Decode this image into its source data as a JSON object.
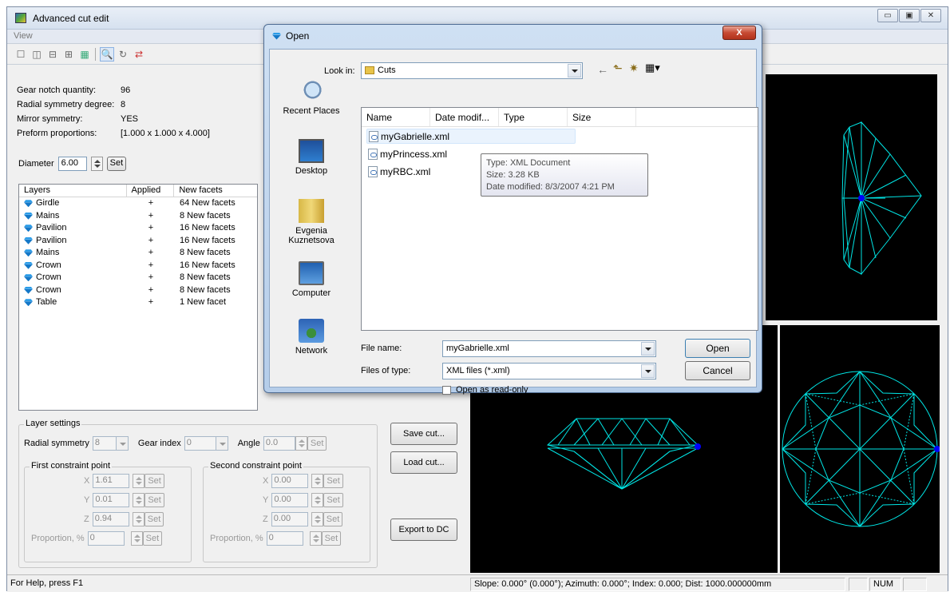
{
  "app": {
    "title": "Advanced cut edit",
    "menu": "View",
    "window_buttons": [
      "▭",
      "▣",
      "✕"
    ]
  },
  "info": {
    "gear_label": "Gear notch quantity:",
    "gear_value": "96",
    "radial_label": "Radial symmetry degree:",
    "radial_value": "8",
    "mirror_label": "Mirror symmetry:",
    "mirror_value": "YES",
    "preform_label": "Preform proportions:",
    "preform_value": "[1.000 x 1.000 x 4.000]",
    "diameter_label": "Diameter",
    "diameter_value": "6.00",
    "set_label": "Set"
  },
  "layers": {
    "headers": [
      "Layers",
      "Applied",
      "New facets"
    ],
    "rows": [
      {
        "name": "Girdle",
        "applied": "+",
        "facets": "64 New facets"
      },
      {
        "name": "Mains",
        "applied": "+",
        "facets": "8 New facets"
      },
      {
        "name": "Pavilion",
        "applied": "+",
        "facets": "16 New facets"
      },
      {
        "name": "Pavilion",
        "applied": "+",
        "facets": "16 New facets"
      },
      {
        "name": "Mains",
        "applied": "+",
        "facets": "8 New facets"
      },
      {
        "name": "Crown",
        "applied": "+",
        "facets": "16 New facets"
      },
      {
        "name": "Crown",
        "applied": "+",
        "facets": "8 New facets"
      },
      {
        "name": "Crown",
        "applied": "+",
        "facets": "8 New facets"
      },
      {
        "name": "Table",
        "applied": "+",
        "facets": "1 New facet"
      }
    ]
  },
  "layer_settings": {
    "title": "Layer settings",
    "radial_label": "Radial symmetry",
    "radial_value": "8",
    "gear_label": "Gear index",
    "gear_value": "0",
    "angle_label": "Angle",
    "angle_value": "0.0",
    "set": "Set",
    "first_title": "First constraint point",
    "second_title": "Second constraint point",
    "x_label": "X",
    "y_label": "Y",
    "z_label": "Z",
    "prop_label": "Proportion, %",
    "first": {
      "x": "1.61",
      "y": "0.01",
      "z": "0.94",
      "p": "0"
    },
    "second": {
      "x": "0.00",
      "y": "0.00",
      "z": "0.00",
      "p": "0"
    }
  },
  "buttons": {
    "save": "Save cut...",
    "load": "Load cut...",
    "export": "Export to DC"
  },
  "status": {
    "help": "For Help, press F1",
    "coords": "Slope: 0.000° (0.000°); Azimuth: 0.000°; Index: 0.000; Dist: 1000.000000mm",
    "num": "NUM"
  },
  "dialog": {
    "title": "Open",
    "close": "X",
    "look_in_label": "Look in:",
    "look_in_value": "Cuts",
    "places": [
      "Recent Places",
      "Desktop",
      "Evgenia Kuznetsova",
      "Computer",
      "Network"
    ],
    "columns": [
      "Name",
      "Date modif...",
      "Type",
      "Size"
    ],
    "files": [
      "myGabrielle.xml",
      "myPrincess.xml",
      "myRBC.xml"
    ],
    "tooltip": {
      "type": "Type: XML Document",
      "size": "Size: 3.28 KB",
      "date": "Date modified: 8/3/2007 4:21 PM"
    },
    "file_name_label": "File name:",
    "file_name_value": "myGabrielle.xml",
    "file_type_label": "Files of type:",
    "file_type_value": "XML files (*.xml)",
    "readonly_label": "Open as read-only",
    "open_btn": "Open",
    "cancel_btn": "Cancel"
  },
  "colors": {
    "wireframe": "#00e5e5",
    "marker": "#0000ff"
  }
}
